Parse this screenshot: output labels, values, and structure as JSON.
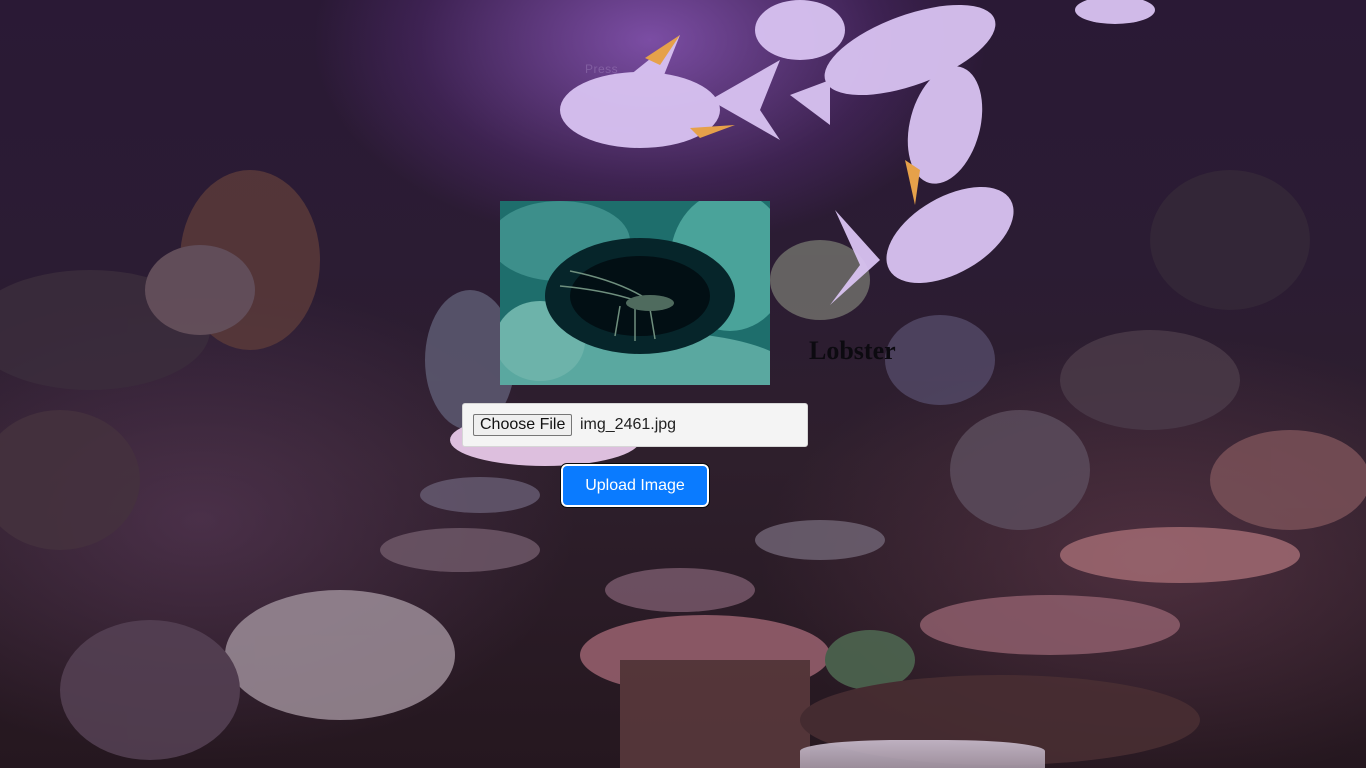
{
  "page": {
    "hint_text": "Press"
  },
  "result": {
    "label": "Lobster"
  },
  "upload_form": {
    "choose_file_label": "Choose File",
    "file_name": "img_2461.jpg",
    "upload_button_label": "Upload Image"
  },
  "colors": {
    "upload_button": "#0a7bff",
    "label_text": "#0c0a10"
  }
}
